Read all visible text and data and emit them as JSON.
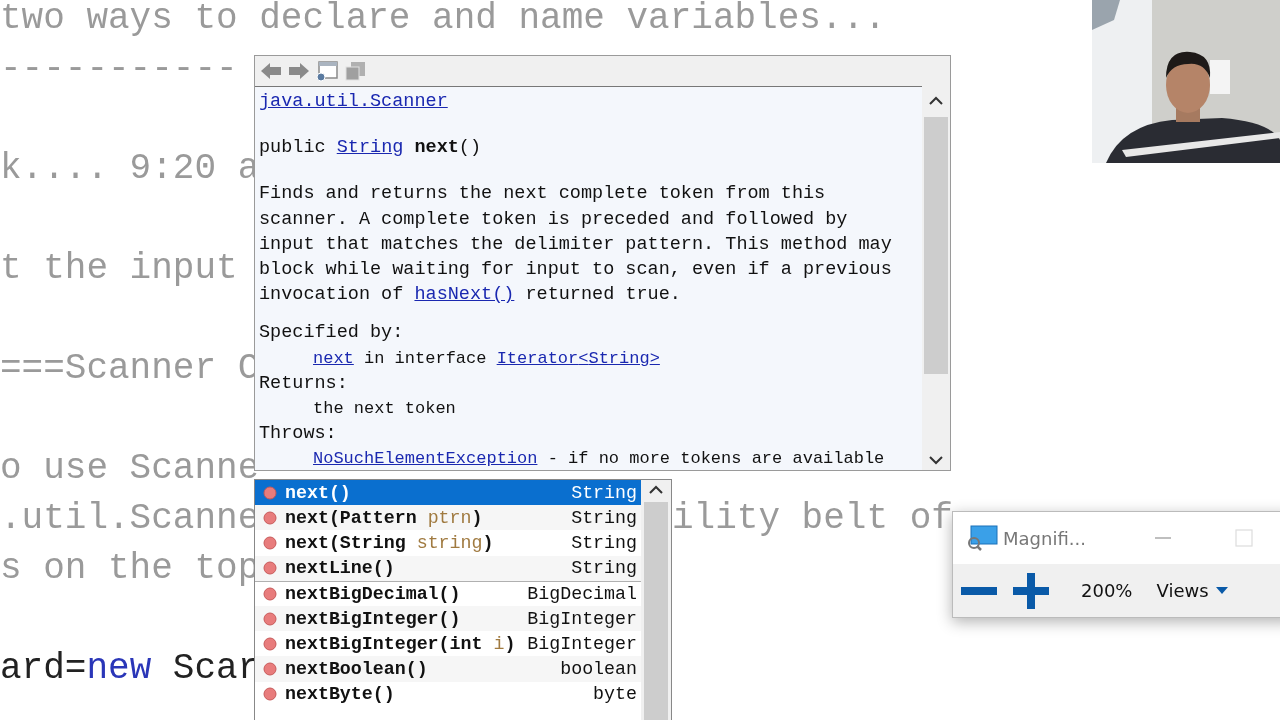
{
  "editor": {
    "lines": [
      {
        "kind": "comment",
        "left": [
          {
            "t": "two ways to declare and name variables..."
          }
        ]
      },
      {
        "kind": "comment",
        "left": [
          {
            "t": "-----------"
          }
        ]
      },
      {
        "kind": "blank"
      },
      {
        "kind": "comment",
        "left": [
          {
            "t": "k.... 9:20 a"
          }
        ]
      },
      {
        "kind": "blank"
      },
      {
        "kind": "comment",
        "left": [
          {
            "t": "t the input"
          }
        ]
      },
      {
        "kind": "blank"
      },
      {
        "kind": "comment",
        "left": [
          {
            "t": "===Scanner C"
          }
        ]
      },
      {
        "kind": "blank"
      },
      {
        "kind": "comment",
        "left": [
          {
            "t": "o use Scanne"
          }
        ]
      },
      {
        "kind": "comment",
        "left": [
          {
            "t": ".util.Scanne"
          }
        ],
        "right": "ility belt of"
      },
      {
        "kind": "comment",
        "left": [
          {
            "t": "s on the top"
          }
        ]
      },
      {
        "kind": "blank"
      },
      {
        "kind": "code",
        "left": [
          {
            "t": "ard="
          },
          {
            "t": "new",
            "kind": "keyword"
          },
          {
            "t": " Scar"
          }
        ]
      }
    ]
  },
  "javadoc": {
    "class_link": "java.util.Scanner",
    "signature": [
      {
        "t": "public "
      },
      {
        "t": "String",
        "kind": "link"
      },
      {
        "t": " next",
        "kind": "bold"
      },
      {
        "t": "()"
      }
    ],
    "description": [
      {
        "t": "Finds and returns the next complete token from this scanner. A complete token is preceded and followed by input that matches the delimiter pattern. This method may block while waiting for input to scan, even if a previous invocation of "
      },
      {
        "t": "hasNext()",
        "kind": "link"
      },
      {
        "t": " returned true."
      }
    ],
    "sections": [
      {
        "heading": "Specified by:",
        "body": [
          {
            "t": "next",
            "kind": "link"
          },
          {
            "t": " in interface "
          },
          {
            "t": "Iterator",
            "kind": "link"
          },
          {
            "t": "<",
            "kind": "link"
          },
          {
            "t": "String",
            "kind": "link"
          },
          {
            "t": ">",
            "kind": "link"
          }
        ]
      },
      {
        "heading": "Returns:",
        "body": [
          {
            "t": "the next token"
          }
        ]
      },
      {
        "heading": "Throws:",
        "body": [
          {
            "t": "NoSuchElementException",
            "kind": "link"
          },
          {
            "t": " - if no more tokens are available"
          }
        ]
      }
    ]
  },
  "completion": {
    "items": [
      {
        "signature": [
          {
            "t": "next()"
          }
        ],
        "type": "String",
        "selected": true,
        "group_start": false
      },
      {
        "signature": [
          {
            "t": "next(Pattern "
          },
          {
            "t": "ptrn",
            "kind": "param"
          },
          {
            "t": ")"
          }
        ],
        "type": "String",
        "selected": false,
        "group_start": false
      },
      {
        "signature": [
          {
            "t": "next(String "
          },
          {
            "t": "string",
            "kind": "param"
          },
          {
            "t": ")"
          }
        ],
        "type": "String",
        "selected": false,
        "group_start": false
      },
      {
        "signature": [
          {
            "t": "nextLine()"
          }
        ],
        "type": "String",
        "selected": false,
        "group_start": false
      },
      {
        "signature": [
          {
            "t": "nextBigDecimal()"
          }
        ],
        "type": "BigDecimal",
        "selected": false,
        "group_start": true
      },
      {
        "signature": [
          {
            "t": "nextBigInteger()"
          }
        ],
        "type": "BigInteger",
        "selected": false,
        "group_start": false
      },
      {
        "signature": [
          {
            "t": "nextBigInteger(int "
          },
          {
            "t": "i",
            "kind": "param"
          },
          {
            "t": ")"
          }
        ],
        "type": "BigInteger",
        "selected": false,
        "group_start": false
      },
      {
        "signature": [
          {
            "t": "nextBoolean()"
          }
        ],
        "type": "boolean",
        "selected": false,
        "group_start": false
      },
      {
        "signature": [
          {
            "t": "nextByte()"
          }
        ],
        "type": "byte",
        "selected": false,
        "group_start": false
      }
    ]
  },
  "magnifier": {
    "title": "Magnifi...",
    "zoom": "200%",
    "views_label": "Views"
  }
}
